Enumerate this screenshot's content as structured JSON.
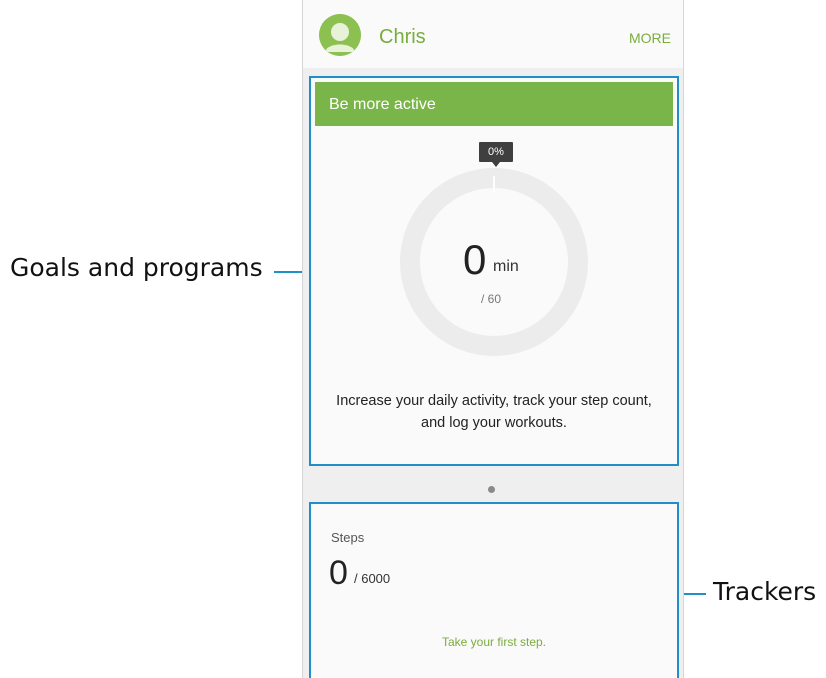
{
  "annotations": {
    "goals": "Goals and programs",
    "trackers": "Trackers"
  },
  "header": {
    "name": "Chris",
    "more": "MORE"
  },
  "goal": {
    "title": "Be more active",
    "progress_label": "0%",
    "progress_fraction": 0,
    "value": "0",
    "unit": "min",
    "target": "/ 60",
    "description": "Increase your daily activity, track your step count, and log your workouts."
  },
  "tracker": {
    "label": "Steps",
    "value": "0",
    "target": "/ 6000",
    "cta": "Take your first step."
  },
  "colors": {
    "accent_green": "#79b548",
    "annotation_blue": "#1f8fc6",
    "ring_gray": "#ececec"
  },
  "icons": {
    "avatar": "avatar-icon"
  }
}
